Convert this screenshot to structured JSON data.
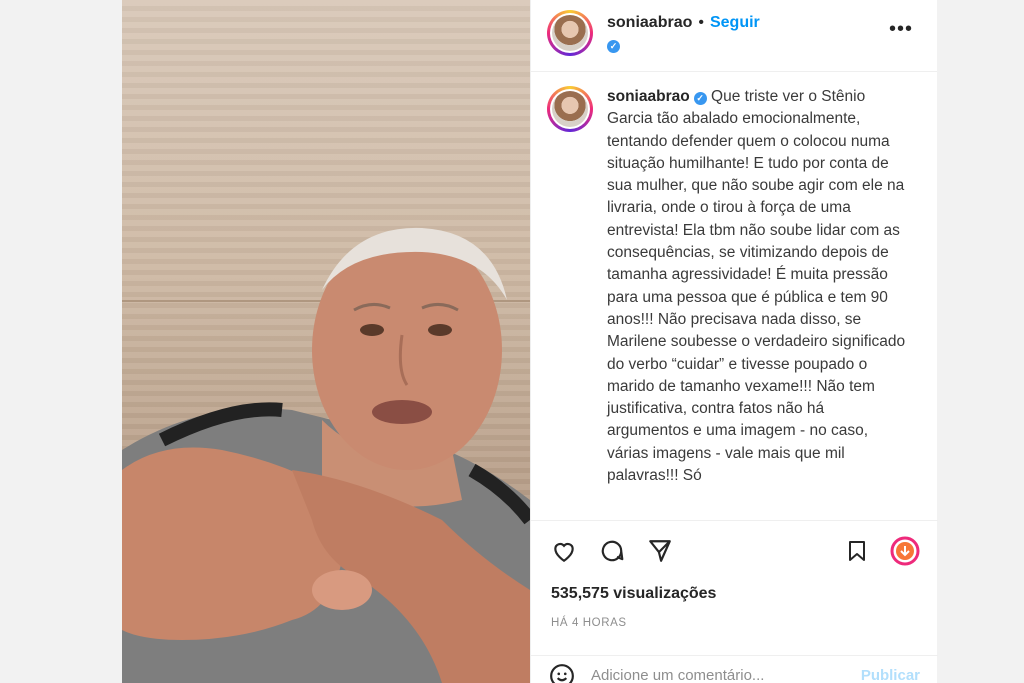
{
  "header": {
    "username": "soniaabrao",
    "separator": "•",
    "follow_label": "Seguir",
    "more_label": "•••"
  },
  "caption": {
    "username": "soniaabrao",
    "text": "Que triste ver o Stênio Garcia tão abalado emocionalmente, tentando defender quem o colocou numa situação humilhante! E tudo por conta de sua mulher, que não soube agir com ele na livraria, onde o tirou à força de uma entrevista! Ela tbm não soube lidar com as consequências, se vitimizando depois de tamanha agressividade! É muita pressão para uma pessoa que é pública e tem 90 anos!!! Não precisava nada disso, se Marilene soubesse o verdadeiro significado do verbo “cuidar” e tivesse poupado o marido de tamanho vexame!!! Não tem justificativa, contra fatos não há argumentos e uma imagem - no caso, várias imagens - vale mais que mil palavras!!! Só"
  },
  "stats": {
    "views": "535,575 visualizações",
    "time_ago": "HÁ 4 HORAS"
  },
  "comment": {
    "placeholder": "Adicione um comentário...",
    "publish_label": "Publicar"
  },
  "icons": {
    "like": "heart-icon",
    "comment": "comment-icon",
    "share": "share-icon",
    "save": "bookmark-icon",
    "download": "download-icon",
    "emoji": "emoji-icon"
  },
  "colors": {
    "accent": "#0095f6",
    "verified": "#3897f0"
  }
}
